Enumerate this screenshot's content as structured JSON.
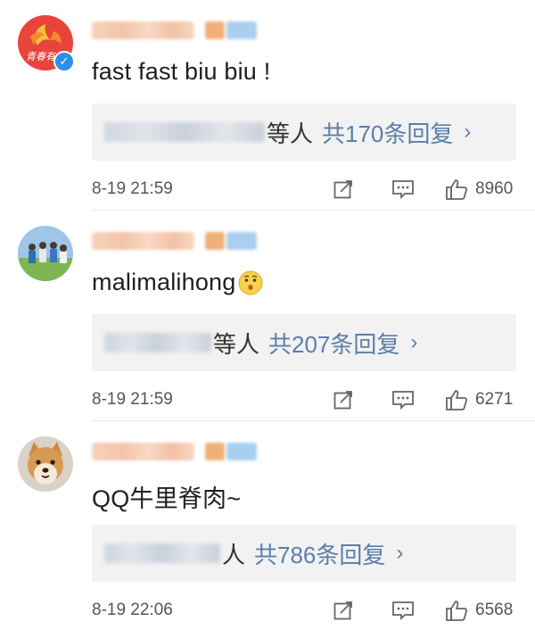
{
  "comments": [
    {
      "text": "fast fast biu biu !",
      "reply_suffix": "等人",
      "reply_count": "共170条回复",
      "time": "8-19 21:59",
      "likes": "8960"
    },
    {
      "text": "malimalihong",
      "reply_suffix": "等人",
      "reply_count": "共207条回复",
      "time": "8-19 21:59",
      "likes": "6271"
    },
    {
      "text": "QQ牛里脊肉~",
      "reply_suffix": "人",
      "reply_count": "共786条回复",
      "time": "8-19 22:06",
      "likes": "6568"
    }
  ],
  "ui": {
    "chevron": "›",
    "verified_mark": "✓",
    "avatar1_text": "青春有你"
  },
  "icons": {
    "share": "share-edit-icon",
    "comment": "comment-bubble-icon",
    "like": "thumbs-up-icon"
  },
  "colors": {
    "link": "#5b7fa8",
    "reply_bg": "#f2f2f2",
    "verified": "#2d8fe7"
  }
}
